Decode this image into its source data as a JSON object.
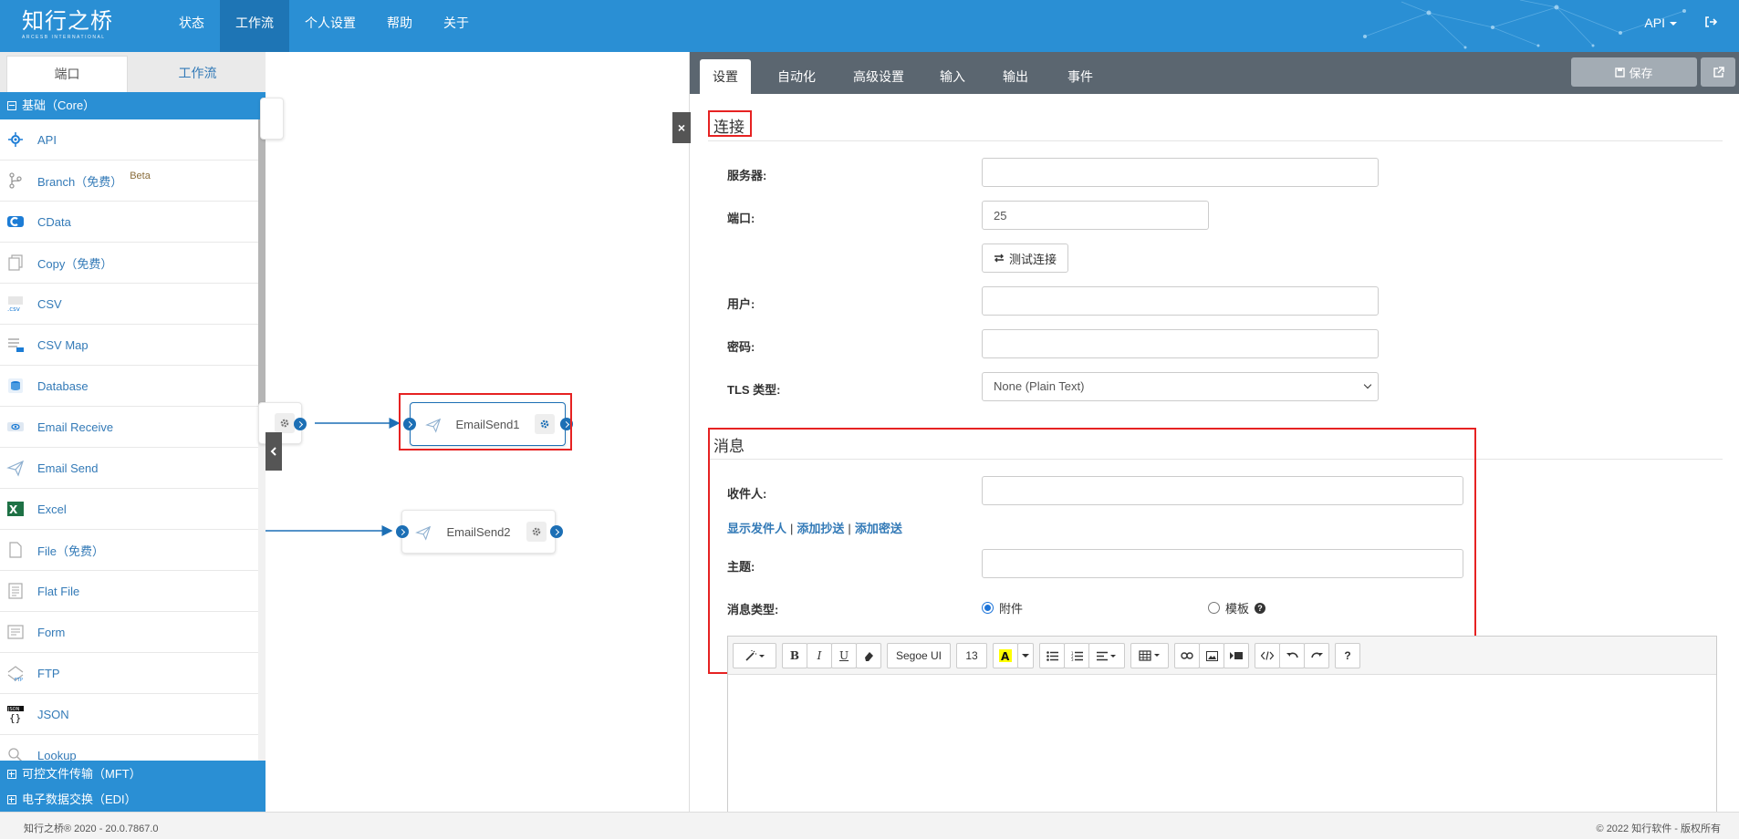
{
  "header": {
    "logo_text": "知行之桥",
    "logo_sub": "ARCESB INTERNATIONAL",
    "nav": [
      {
        "label": "状态"
      },
      {
        "label": "工作流"
      },
      {
        "label": "个人设置"
      },
      {
        "label": "帮助"
      },
      {
        "label": "关于"
      }
    ],
    "active_nav": "工作流",
    "user_menu": "API"
  },
  "sidebar": {
    "tabs": [
      {
        "label": "端口"
      },
      {
        "label": "工作流"
      }
    ],
    "category_core": "基础（Core）",
    "connectors": [
      {
        "label": "API",
        "icon": "api-icon"
      },
      {
        "label": "Branch（免费）",
        "icon": "branch-icon",
        "badge": "Beta"
      },
      {
        "label": "CData",
        "icon": "cdata-icon"
      },
      {
        "label": "Copy（免费）",
        "icon": "copy-icon"
      },
      {
        "label": "CSV",
        "icon": "csv-icon"
      },
      {
        "label": "CSV Map",
        "icon": "csv-map-icon"
      },
      {
        "label": "Database",
        "icon": "database-icon"
      },
      {
        "label": "Email Receive",
        "icon": "email-receive-icon"
      },
      {
        "label": "Email Send",
        "icon": "email-send-icon"
      },
      {
        "label": "Excel",
        "icon": "excel-icon"
      },
      {
        "label": "File（免费）",
        "icon": "file-icon"
      },
      {
        "label": "Flat File",
        "icon": "flat-file-icon"
      },
      {
        "label": "Form",
        "icon": "form-icon"
      },
      {
        "label": "FTP",
        "icon": "ftp-icon"
      },
      {
        "label": "JSON",
        "icon": "json-icon"
      },
      {
        "label": "Lookup",
        "icon": "lookup-icon"
      }
    ],
    "category_mft": "可控文件传输（MFT）",
    "category_edi": "电子数据交换（EDI）"
  },
  "canvas": {
    "node1": "EmailSend1",
    "node2": "EmailSend2"
  },
  "panel": {
    "tabs": [
      {
        "label": "设置"
      },
      {
        "label": "自动化"
      },
      {
        "label": "高级设置"
      },
      {
        "label": "输入"
      },
      {
        "label": "输出"
      },
      {
        "label": "事件"
      }
    ],
    "save_label": "保存",
    "connection": {
      "title": "连接",
      "server_label": "服务器:",
      "server_value": "",
      "port_label": "端口:",
      "port_value": "25",
      "test_button": "测试连接",
      "user_label": "用户:",
      "user_value": "",
      "password_label": "密码:",
      "password_value": "",
      "tls_label": "TLS 类型:",
      "tls_value": "None (Plain Text)"
    },
    "message": {
      "title": "消息",
      "to_label": "收件人:",
      "to_value": "",
      "link_show_from": "显示发件人",
      "link_add_cc": "添加抄送",
      "link_add_bcc": "添加密送",
      "subject_label": "主题:",
      "subject_value": "",
      "type_label": "消息类型:",
      "type_option_attachment": "附件",
      "type_option_template": "模板",
      "type_selected": "附件"
    },
    "editor": {
      "font_name": "Segoe UI",
      "font_size": "13"
    }
  },
  "footer": {
    "version": "知行之桥® 2020 - 20.0.7867.0",
    "copyright": "© 2022 知行软件 - 版权所有"
  },
  "colors": {
    "brand_blue": "#2a8fd4",
    "nav_active": "#1e75b5",
    "panel_tabs": "#5b6670",
    "highlight_red": "#e62222",
    "port_blue": "#1c6fb5"
  }
}
